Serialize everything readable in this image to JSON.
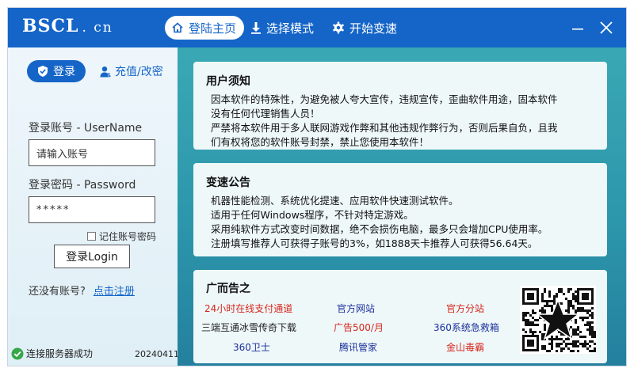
{
  "app": {
    "brand": "BSCL",
    "brand_suffix": ". cn"
  },
  "nav": {
    "tabs": [
      {
        "label": "登陆主页",
        "icon": "home-icon",
        "active": true
      },
      {
        "label": "选择模式",
        "icon": "download-icon",
        "active": false
      },
      {
        "label": "开始变速",
        "icon": "gear-icon",
        "active": false
      }
    ]
  },
  "window_controls": {
    "minimize_icon": "minimize-icon",
    "close_icon": "close-icon"
  },
  "login": {
    "tab_login": "登录",
    "tab_recharge": "充值/改密",
    "username_label": "登录账号 - UserName",
    "username_placeholder": "请输入账号",
    "password_label": "登录密码 - Password",
    "password_value": "*****",
    "remember_label": "记住账号密码",
    "remember_checked": false,
    "login_button": "登录Login",
    "no_account_text": "还没有账号?",
    "register_link": "点击注册"
  },
  "status": {
    "text": "连接服务器成功",
    "version": "20240411",
    "ok_color": "#37a64a"
  },
  "notice": {
    "title": "用户须知",
    "lines": [
      "因本软件的特殊性，为避免被人夸大宣传，违规宣传，歪曲软件用途，固本软件",
      "没有任何代理销售人员！",
      "严禁将本软件用于多人联网游戏作弊和其他违规作弊行为，否则后果自负，且我",
      "们有权将您的软件账号封禁，禁止您使用本软件！"
    ]
  },
  "announcement": {
    "title": "变速公告",
    "lines": [
      "机器性能检测、系统优化提速、应用软件快速测试软件。",
      "适用于任何Windows程序，不针对特定游戏。",
      "采用纯软件方式改变时间数据，绝不会损伤电脑，最多只会增加CPU使用率。",
      "注册填写推荐人可获得子账号的3%，如1888天卡推荐人可获得56.64天。"
    ]
  },
  "ads": {
    "title": "广而告之",
    "items": [
      {
        "label": "24小时在线支付通道",
        "color": "#d7261c"
      },
      {
        "label": "官方网站",
        "color": "#1c2f9c"
      },
      {
        "label": "官方分站",
        "color": "#d7261c"
      },
      {
        "label": "三端互通冰雪传奇下载",
        "color": "#222222"
      },
      {
        "label": "广告500/月",
        "color": "#d7261c"
      },
      {
        "label": "360系统急救箱",
        "color": "#1c2f9c"
      },
      {
        "label": "360卫士",
        "color": "#1c2f9c"
      },
      {
        "label": "腾讯管家",
        "color": "#1c2f9c"
      },
      {
        "label": "金山毒霸",
        "color": "#d7261c"
      }
    ],
    "qr_icon": "qr-code-icon"
  },
  "colors": {
    "accent": "#1565c8",
    "panel": "#2c96ab"
  }
}
